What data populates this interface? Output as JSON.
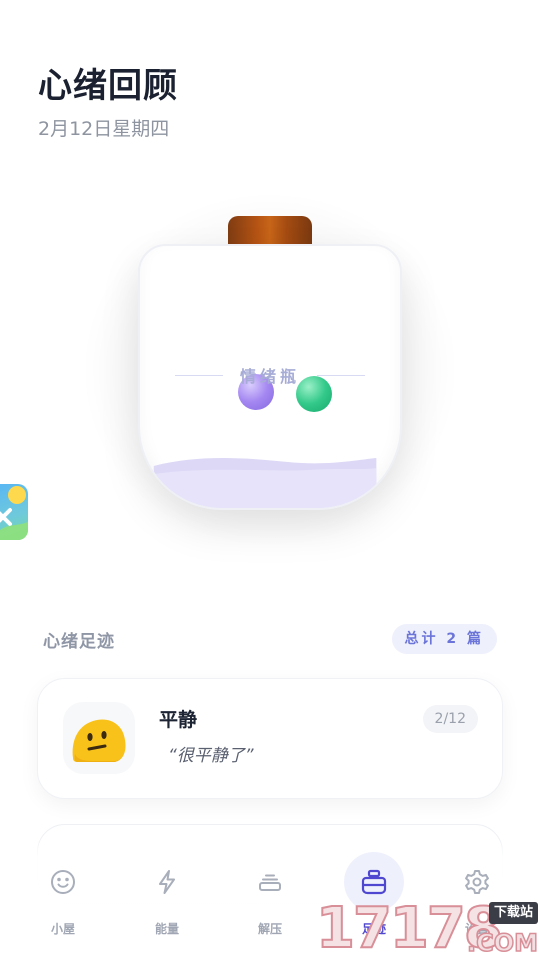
{
  "header": {
    "title": "心绪回顾",
    "date": "2月12日星期四"
  },
  "jar": {
    "caption": "情绪瓶",
    "bubbles": [
      "purple-bubble",
      "green-bubble"
    ]
  },
  "section": {
    "title": "心绪足迹",
    "count_badge": "总计 2 篇"
  },
  "entries": [
    {
      "emoji": "neutral-face-icon",
      "mood": "平静",
      "quote": "“很平静了”",
      "pager": "2/12"
    }
  ],
  "tabs": [
    {
      "label": "小屋",
      "icon": "smile-icon",
      "active": false
    },
    {
      "label": "能量",
      "icon": "lightning-icon",
      "active": false
    },
    {
      "label": "解压",
      "icon": "stack-icon",
      "active": false
    },
    {
      "label": "足迹",
      "icon": "jar-icon",
      "active": true
    },
    {
      "label": "设置",
      "icon": "gear-icon",
      "active": false
    }
  ],
  "watermark": {
    "digits": "17178",
    "tag": "下载站",
    "domain": ".COM"
  },
  "colors": {
    "accent": "#4f47cf",
    "badge_bg": "#eef0fc",
    "lid": "#b65414",
    "purple": "#a487f1",
    "green": "#33c98a",
    "liquid": "#dcd8f6"
  }
}
